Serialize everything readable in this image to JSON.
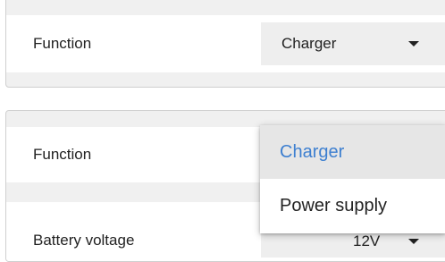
{
  "card1": {
    "function_label": "Function",
    "function_value": "Charger"
  },
  "card2": {
    "function_label": "Function",
    "battery_label": "Battery voltage",
    "battery_value": "12V"
  },
  "dropdown": {
    "options": [
      {
        "label": "Charger",
        "selected": true
      },
      {
        "label": "Power supply",
        "selected": false
      }
    ]
  },
  "colors": {
    "accent": "#3d7fd0",
    "panel_bg": "#f0f0f0",
    "select_bg": "#eeeeee"
  },
  "icons": {
    "caret": "chevron-down-icon"
  }
}
